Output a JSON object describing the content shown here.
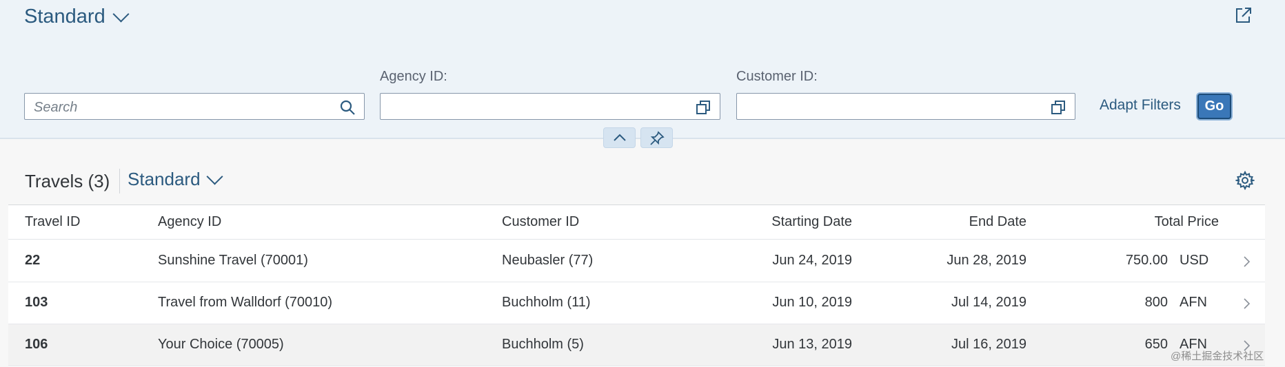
{
  "header": {
    "variant_title": "Standard",
    "search_placeholder": "Search",
    "agency_label": "Agency ID:",
    "agency_value": "",
    "customer_label": "Customer ID:",
    "customer_value": "",
    "adapt_filters_label": "Adapt Filters",
    "go_label": "Go",
    "icons": {
      "share": "share-icon",
      "search": "search-icon",
      "value_help": "value-help-icon",
      "collapse": "chevron-up-icon",
      "pin": "pin-icon"
    }
  },
  "table": {
    "title": "Travels (3)",
    "variant_title": "Standard",
    "settings_icon": "gear-icon",
    "columns": [
      "Travel ID",
      "Agency ID",
      "Customer ID",
      "Starting Date",
      "End Date",
      "Total Price"
    ],
    "rows": [
      {
        "travel_id": "22",
        "agency": "Sunshine Travel (70001)",
        "customer": "Neubasler (77)",
        "start": "Jun 24, 2019",
        "end": "Jun 28, 2019",
        "price": "750.00",
        "currency": "USD"
      },
      {
        "travel_id": "103",
        "agency": "Travel from Walldorf (70010)",
        "customer": "Buchholm (11)",
        "start": "Jun 10, 2019",
        "end": "Jul 14, 2019",
        "price": "800",
        "currency": "AFN"
      },
      {
        "travel_id": "106",
        "agency": "Your Choice (70005)",
        "customer": "Buchholm (5)",
        "start": "Jun 13, 2019",
        "end": "Jul 16, 2019",
        "price": "650",
        "currency": "AFN"
      }
    ]
  },
  "watermark": "@稀土掘金技术社区",
  "colors": {
    "accent": "#2b5a7f",
    "go_button": "#3a77b8",
    "header_bg": "#edf3f8"
  }
}
